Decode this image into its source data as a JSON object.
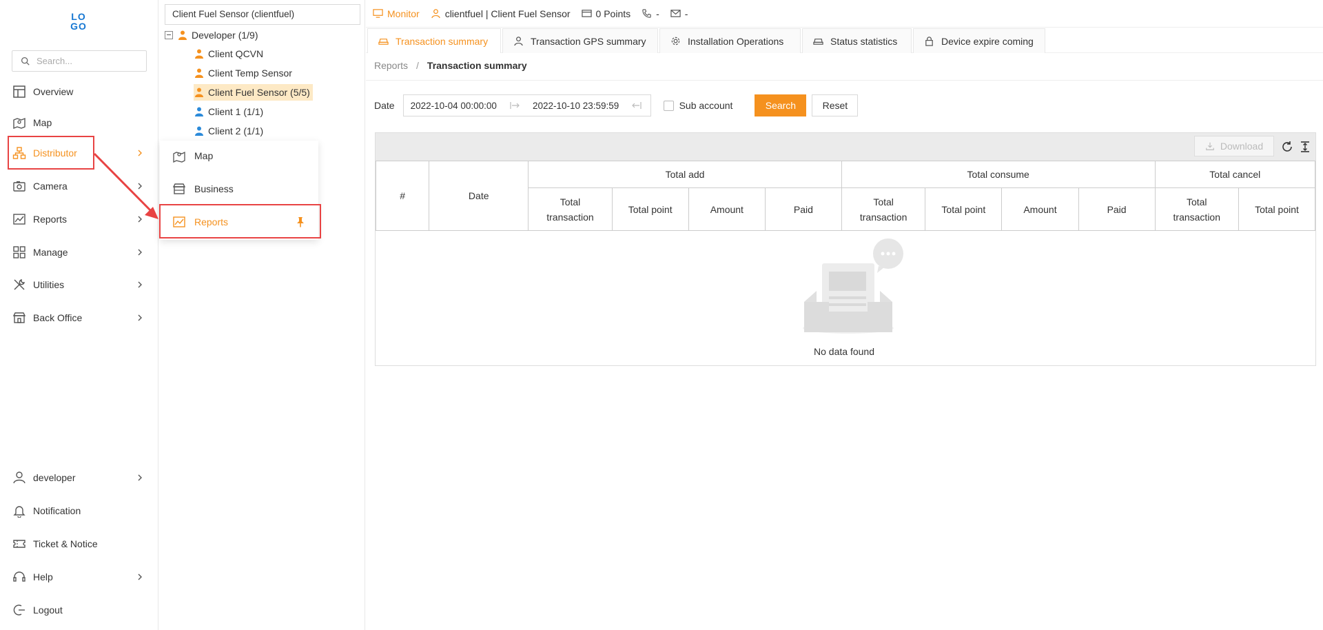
{
  "logo": {
    "text": "LO\nGO"
  },
  "sidebar": {
    "search_placeholder": "Search...",
    "items": [
      {
        "label": "Overview"
      },
      {
        "label": "Map"
      },
      {
        "label": "Distributor"
      },
      {
        "label": "Camera"
      },
      {
        "label": "Reports"
      },
      {
        "label": "Manage"
      },
      {
        "label": "Utilities"
      },
      {
        "label": "Back Office"
      }
    ],
    "bottom_items": [
      {
        "label": "developer"
      },
      {
        "label": "Notification"
      },
      {
        "label": "Ticket & Notice"
      },
      {
        "label": "Help"
      },
      {
        "label": "Logout"
      }
    ]
  },
  "flyout": {
    "items": [
      {
        "label": "Map"
      },
      {
        "label": "Business"
      },
      {
        "label": "Reports"
      }
    ]
  },
  "tree": {
    "selected_account": "Client Fuel Sensor (clientfuel)",
    "root": {
      "label": "Developer (1/9)"
    },
    "children": [
      {
        "label": "Client QCVN"
      },
      {
        "label": "Client Temp Sensor"
      },
      {
        "label": "Client Fuel Sensor (5/5)"
      },
      {
        "label": "Client 1 (1/1)"
      },
      {
        "label": "Client 2 (1/1)"
      }
    ]
  },
  "topbar": {
    "monitor": "Monitor",
    "user": "clientfuel | Client Fuel Sensor",
    "points": "0 Points",
    "phone": "-",
    "email": "-"
  },
  "tabs": [
    {
      "label": "Transaction summary"
    },
    {
      "label": "Transaction GPS summary"
    },
    {
      "label": "Installation Operations"
    },
    {
      "label": "Status statistics"
    },
    {
      "label": "Device expire coming"
    }
  ],
  "breadcrumb": {
    "root": "Reports",
    "separator": "/",
    "current": "Transaction summary"
  },
  "filter": {
    "date_label": "Date",
    "start": "2022-10-04 00:00:00",
    "end": "2022-10-10 23:59:59",
    "sub_account_label": "Sub account",
    "search_label": "Search",
    "reset_label": "Reset"
  },
  "grid": {
    "download_label": "Download",
    "col_index": "#",
    "col_date": "Date",
    "groups": [
      {
        "label": "Total add",
        "cols": [
          "Total transaction",
          "Total point",
          "Amount",
          "Paid"
        ]
      },
      {
        "label": "Total consume",
        "cols": [
          "Total transaction",
          "Total point",
          "Amount",
          "Paid"
        ]
      },
      {
        "label": "Total cancel",
        "cols": [
          "Total transaction",
          "Total point"
        ]
      }
    ],
    "empty_text": "No data found"
  },
  "colors": {
    "accent": "#f5911e",
    "highlight": "#e84343",
    "user_blue": "#2b8ad9"
  }
}
